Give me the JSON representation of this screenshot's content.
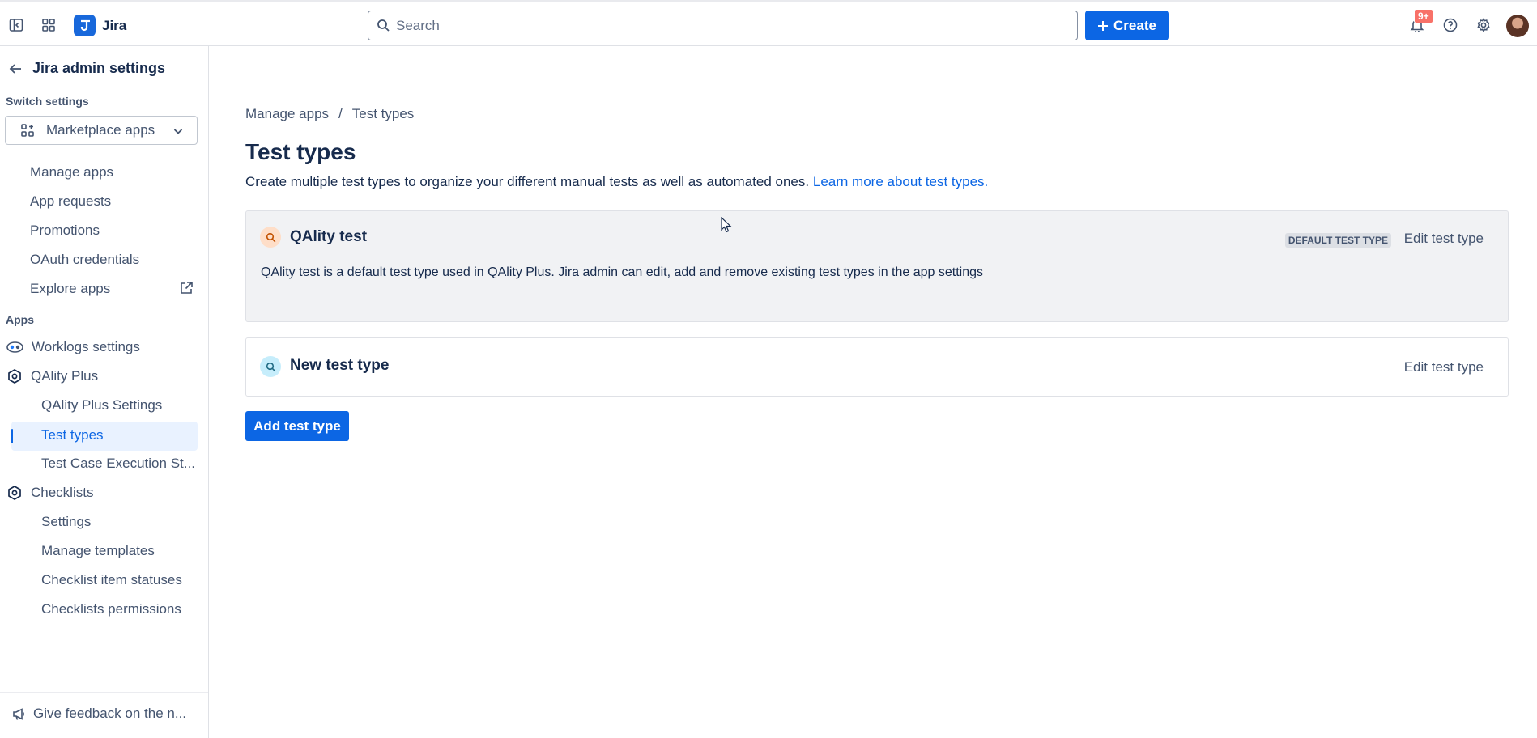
{
  "app": {
    "name": "Jira"
  },
  "topbar": {
    "search_placeholder": "Search",
    "create_label": "Create",
    "notification_count": "9+"
  },
  "sidebar": {
    "title": "Jira admin settings",
    "switch_settings_label": "Switch settings",
    "switcher_value": "Marketplace apps",
    "items": [
      "Manage apps",
      "App requests",
      "Promotions",
      "OAuth credentials",
      "Explore apps"
    ],
    "apps_label": "Apps",
    "apps": {
      "worklogs": "Worklogs settings",
      "qality": "QAlity Plus",
      "qality_sub": [
        "QAlity Plus Settings",
        "Test types",
        "Test Case Execution St..."
      ],
      "checklists": "Checklists",
      "checklists_sub": [
        "Settings",
        "Manage templates",
        "Checklist item statuses",
        "Checklists permissions"
      ]
    },
    "feedback": "Give feedback on the n..."
  },
  "main": {
    "breadcrumb": [
      "Manage apps",
      "/",
      "Test types"
    ],
    "title": "Test types",
    "description": "Create multiple test types to organize your different manual tests as well as automated ones.",
    "learn_more": "Learn more about test types.",
    "test_types": [
      {
        "name": "QAlity test",
        "description": "QAlity test is a default test type used in QAlity Plus. Jira admin can edit, add and remove existing test types in the app settings",
        "lozenge": "DEFAULT TEST TYPE",
        "edit_label": "Edit test type",
        "icon_color": "#fedec8"
      },
      {
        "name": "New test type",
        "edit_label": "Edit test type",
        "icon_color": "#c6edfb"
      }
    ],
    "add_button": "Add test type"
  },
  "colors": {
    "accent": "#0c66e4",
    "badge": "#f87168"
  }
}
